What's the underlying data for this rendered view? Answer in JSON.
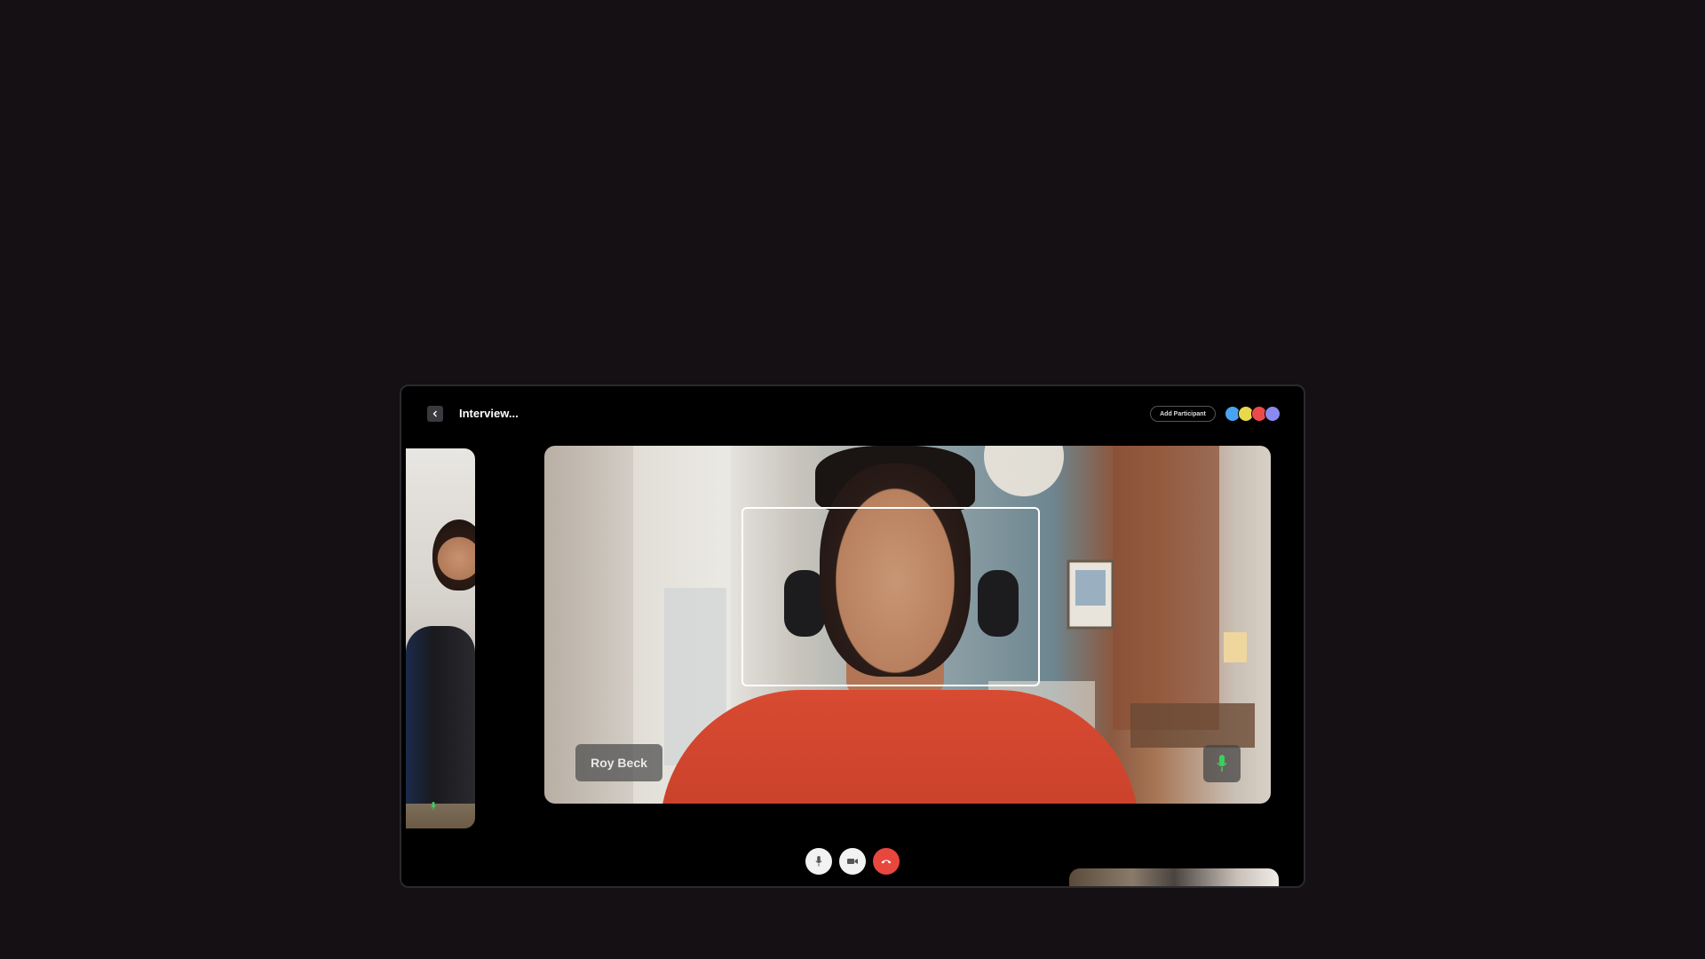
{
  "header": {
    "title": "Interview...",
    "add_participant_label": "Add Participant",
    "participants": [
      {
        "initial": "",
        "color": "#4aa3f0"
      },
      {
        "initial": "",
        "color": "#e8d84a"
      },
      {
        "initial": "",
        "color": "#ea4a4a"
      },
      {
        "initial": "",
        "color": "#8a8af0"
      }
    ]
  },
  "main_video": {
    "participant_name": "Roy Beck",
    "mic_state": "on",
    "face_detection": true
  },
  "side_tile": {
    "mic_state": "on"
  },
  "controls": {
    "mic_icon": "mic-icon",
    "camera_icon": "video-camera-icon",
    "end_call_icon": "phone-hangup-icon"
  },
  "colors": {
    "background": "#141014",
    "window": "#000000",
    "end_call": "#e8473e",
    "mic_active": "#3ccf5a"
  }
}
